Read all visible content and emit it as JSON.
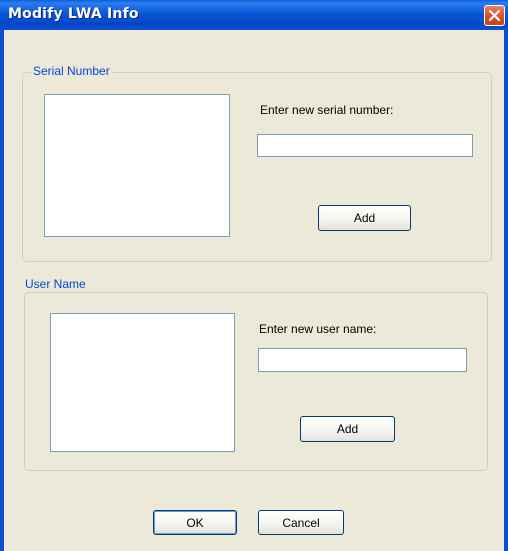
{
  "window": {
    "title": "Modify LWA Info"
  },
  "serial_group": {
    "label": "Serial Number",
    "prompt": "Enter new serial number:",
    "input_value": "",
    "add_label": "Add"
  },
  "user_group": {
    "label": "User Name",
    "prompt": "Enter new user name:",
    "input_value": "",
    "add_label": "Add"
  },
  "footer": {
    "ok_label": "OK",
    "cancel_label": "Cancel"
  },
  "colors": {
    "titlebar": "#0b56d6",
    "dialog_bg": "#ece9d8",
    "group_label": "#0046d5",
    "close_button": "#d9542a"
  },
  "icons": {
    "close": "close-icon"
  }
}
